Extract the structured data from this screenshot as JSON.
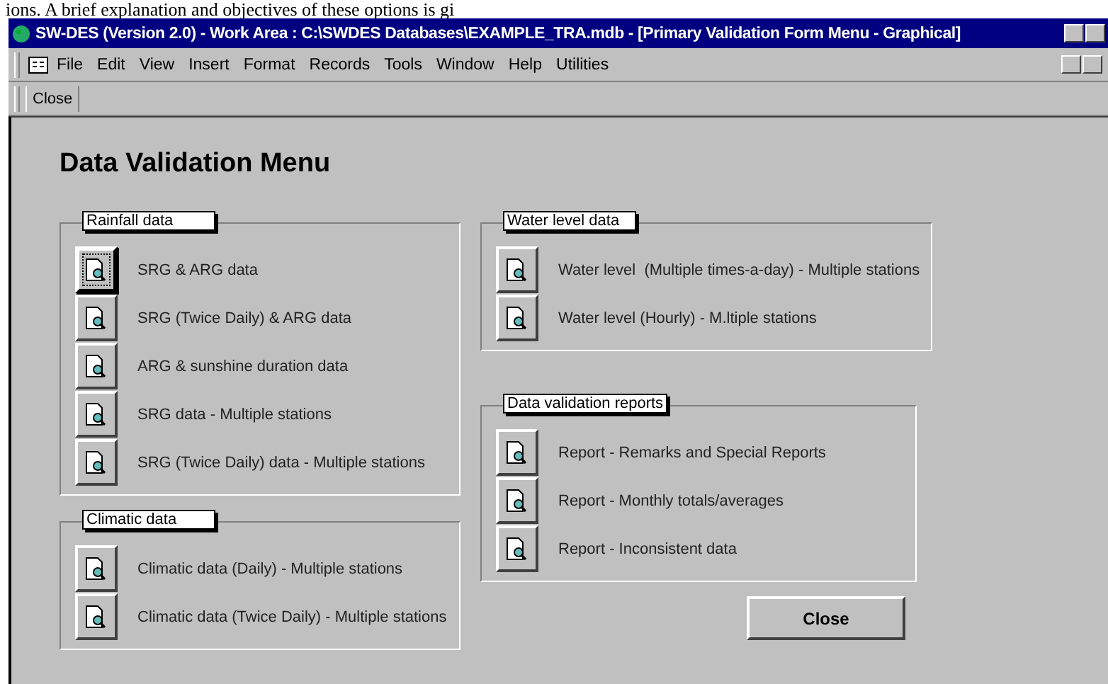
{
  "document_text": "ions. A brief explanation and objectives of these options is gi",
  "window": {
    "title": "SW-DES (Version 2.0) - Work Area : C:\\SWDES Databases\\EXAMPLE_TRA.mdb - [Primary Validation Form Menu - Graphical]"
  },
  "menu": [
    {
      "label": "File"
    },
    {
      "label": "Edit"
    },
    {
      "label": "View"
    },
    {
      "label": "Insert"
    },
    {
      "label": "Format"
    },
    {
      "label": "Records"
    },
    {
      "label": "Tools"
    },
    {
      "label": "Window"
    },
    {
      "label": "Help"
    },
    {
      "label": "Utilities"
    }
  ],
  "toolbar": {
    "close": {
      "label": "Close"
    }
  },
  "form": {
    "heading": "Data Validation Menu",
    "groups_left": [
      {
        "title": "Rainfall data",
        "items": [
          {
            "label": "SRG & ARG data",
            "focused": true
          },
          {
            "label": "SRG (Twice Daily) & ARG data",
            "focused": false
          },
          {
            "label": "ARG & sunshine duration data",
            "focused": false
          },
          {
            "label": "SRG data - Multiple stations",
            "focused": false
          },
          {
            "label": "SRG (Twice Daily) data - Multiple stations",
            "focused": false
          }
        ]
      },
      {
        "title": "Climatic data",
        "items": [
          {
            "label": "Climatic data (Daily) - Multiple stations",
            "focused": false
          },
          {
            "label": "Climatic data (Twice Daily) - Multiple stations",
            "focused": false
          }
        ]
      }
    ],
    "groups_right": [
      {
        "title": "Water level data",
        "items": [
          {
            "label": "Water level  (Multiple times-a-day) - Multiple stations",
            "focused": false
          },
          {
            "label": "Water level (Hourly) - M.ltiple stations",
            "focused": false
          }
        ]
      },
      {
        "title": "Data validation reports",
        "items": [
          {
            "label": "Report - Remarks and Special Reports",
            "focused": false
          },
          {
            "label": "Report - Monthly totals/averages",
            "focused": false
          },
          {
            "label": "Report - Inconsistent data",
            "focused": false
          }
        ]
      }
    ],
    "close_button": {
      "label": "Close"
    }
  }
}
